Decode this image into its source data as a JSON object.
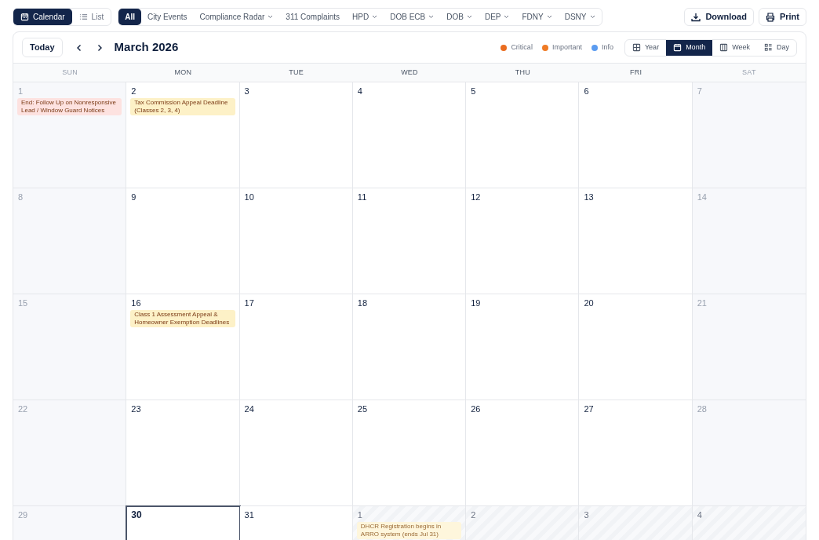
{
  "view_mode": [
    {
      "label": "Calendar",
      "kind": "calendar",
      "selected": true
    },
    {
      "label": "List",
      "kind": "list",
      "selected": false
    }
  ],
  "filters": [
    {
      "label": "All",
      "selected": true,
      "dropdown": false
    },
    {
      "label": "City Events",
      "selected": false,
      "dropdown": false
    },
    {
      "label": "Compliance Radar",
      "selected": false,
      "dropdown": true
    },
    {
      "label": "311 Complaints",
      "selected": false,
      "dropdown": false
    },
    {
      "label": "HPD",
      "selected": false,
      "dropdown": true
    },
    {
      "label": "DOB ECB",
      "selected": false,
      "dropdown": true
    },
    {
      "label": "DOB",
      "selected": false,
      "dropdown": true
    },
    {
      "label": "DEP",
      "selected": false,
      "dropdown": true
    },
    {
      "label": "FDNY",
      "selected": false,
      "dropdown": true
    },
    {
      "label": "DSNY",
      "selected": false,
      "dropdown": true
    }
  ],
  "actions": [
    {
      "label": "Download",
      "kind": "download"
    },
    {
      "label": "Print",
      "kind": "print"
    }
  ],
  "toolbar": {
    "today": "Today",
    "title": "March 2026"
  },
  "legend": [
    {
      "label": "Critical",
      "color": "#ea6c1f"
    },
    {
      "label": "Important",
      "color": "#ef7b25"
    },
    {
      "label": "Info",
      "color": "#5b9cf0"
    }
  ],
  "ranges": [
    {
      "label": "Year",
      "kind": "year",
      "selected": false
    },
    {
      "label": "Month",
      "kind": "month",
      "selected": true
    },
    {
      "label": "Week",
      "kind": "week",
      "selected": false
    },
    {
      "label": "Day",
      "kind": "day",
      "selected": false
    }
  ],
  "weekdays": [
    {
      "label": "SUN",
      "weekend": true
    },
    {
      "label": "MON",
      "weekend": false
    },
    {
      "label": "TUE",
      "weekend": false
    },
    {
      "label": "WED",
      "weekend": false
    },
    {
      "label": "THU",
      "weekend": false
    },
    {
      "label": "FRI",
      "weekend": false
    },
    {
      "label": "SAT",
      "weekend": true
    }
  ],
  "weeks": [
    [
      {
        "day": "1",
        "kind": "weekend",
        "events": [
          {
            "title": "End: Follow Up on Nonresponsive Lead / Window Guard Notices",
            "color": "#fde2e0"
          }
        ]
      },
      {
        "day": "2",
        "kind": "weekday",
        "events": [
          {
            "title": "Tax Commission Appeal Deadline (Classes 2, 3, 4)",
            "color": "#fdf1c7"
          }
        ]
      },
      {
        "day": "3",
        "kind": "weekday"
      },
      {
        "day": "4",
        "kind": "weekday"
      },
      {
        "day": "5",
        "kind": "weekday"
      },
      {
        "day": "6",
        "kind": "weekday"
      },
      {
        "day": "7",
        "kind": "weekend"
      }
    ],
    [
      {
        "day": "8",
        "kind": "weekend"
      },
      {
        "day": "9",
        "kind": "weekday"
      },
      {
        "day": "10",
        "kind": "weekday"
      },
      {
        "day": "11",
        "kind": "weekday"
      },
      {
        "day": "12",
        "kind": "weekday"
      },
      {
        "day": "13",
        "kind": "weekday"
      },
      {
        "day": "14",
        "kind": "weekend"
      }
    ],
    [
      {
        "day": "15",
        "kind": "weekend"
      },
      {
        "day": "16",
        "kind": "weekday",
        "events": [
          {
            "title": "Class 1 Assessment Appeal & Homeowner Exemption Deadlines",
            "color": "#fdf1c7"
          }
        ]
      },
      {
        "day": "17",
        "kind": "weekday"
      },
      {
        "day": "18",
        "kind": "weekday"
      },
      {
        "day": "19",
        "kind": "weekday"
      },
      {
        "day": "20",
        "kind": "weekday"
      },
      {
        "day": "21",
        "kind": "weekend"
      }
    ],
    [
      {
        "day": "22",
        "kind": "weekend"
      },
      {
        "day": "23",
        "kind": "weekday"
      },
      {
        "day": "24",
        "kind": "weekday"
      },
      {
        "day": "25",
        "kind": "weekday"
      },
      {
        "day": "26",
        "kind": "weekday"
      },
      {
        "day": "27",
        "kind": "weekday"
      },
      {
        "day": "28",
        "kind": "weekend"
      }
    ],
    [
      {
        "day": "29",
        "kind": "weekend"
      },
      {
        "day": "30",
        "kind": "today"
      },
      {
        "day": "31",
        "kind": "weekday"
      },
      {
        "day": "1",
        "kind": "outside",
        "events": [
          {
            "title": "DHCR Registration begins in ARRO system (ends Jul 31)",
            "color": "#fef6dc"
          }
        ]
      },
      {
        "day": "2",
        "kind": "outside"
      },
      {
        "day": "3",
        "kind": "outside"
      },
      {
        "day": "4",
        "kind": "outside"
      }
    ]
  ]
}
